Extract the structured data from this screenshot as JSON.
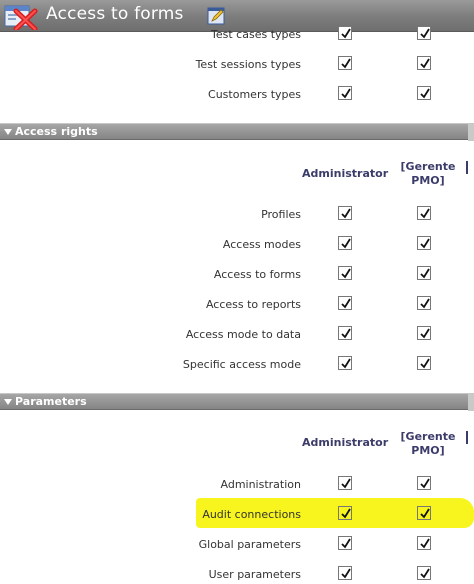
{
  "window": {
    "title": "Access to forms"
  },
  "sections": {
    "top_rows": [
      {
        "label": "Test cases types",
        "checked": [
          true,
          true
        ]
      },
      {
        "label": "Test sessions types",
        "checked": [
          true,
          true
        ]
      },
      {
        "label": "Customers types",
        "checked": [
          true,
          true
        ]
      }
    ],
    "access_rights": {
      "title": "Access rights",
      "columns": [
        "Administrator",
        "[Gerente",
        "PMO]"
      ],
      "rows": [
        {
          "label": "Profiles",
          "checked": [
            true,
            true
          ]
        },
        {
          "label": "Access modes",
          "checked": [
            true,
            true
          ]
        },
        {
          "label": "Access to forms",
          "checked": [
            true,
            true
          ]
        },
        {
          "label": "Access to reports",
          "checked": [
            true,
            true
          ]
        },
        {
          "label": "Access mode to data",
          "checked": [
            true,
            true
          ]
        },
        {
          "label": "Specific access mode",
          "checked": [
            true,
            true
          ]
        }
      ]
    },
    "parameters": {
      "title": "Parameters",
      "columns": [
        "Administrator",
        "[Gerente",
        "PMO]"
      ],
      "rows": [
        {
          "label": "Administration",
          "checked": [
            true,
            true
          ]
        },
        {
          "label": "Audit connections",
          "checked": [
            true,
            true
          ],
          "highlighted": true
        },
        {
          "label": "Global parameters",
          "checked": [
            true,
            true
          ]
        },
        {
          "label": "User parameters",
          "checked": [
            true,
            true
          ]
        }
      ]
    }
  },
  "colors": {
    "highlight": "#f7f51d",
    "section_bar": "#8f8f8f",
    "header_text": "#3c3c6a"
  },
  "icons": {
    "app": "forms-delete-icon",
    "edit": "edit-icon",
    "check": "checkmark-icon",
    "collapse": "triangle-down-icon"
  }
}
